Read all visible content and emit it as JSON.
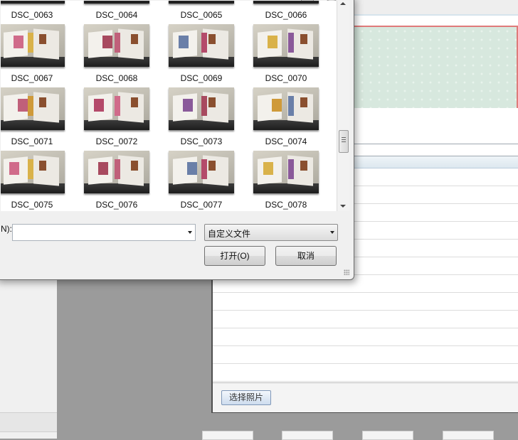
{
  "file_dialog": {
    "files": [
      {
        "name": "DSC_0063"
      },
      {
        "name": "DSC_0064"
      },
      {
        "name": "DSC_0065"
      },
      {
        "name": "DSC_0066"
      },
      {
        "name": "DSC_0067"
      },
      {
        "name": "DSC_0068"
      },
      {
        "name": "DSC_0069"
      },
      {
        "name": "DSC_0070"
      },
      {
        "name": "DSC_0071"
      },
      {
        "name": "DSC_0072"
      },
      {
        "name": "DSC_0073"
      },
      {
        "name": "DSC_0074"
      },
      {
        "name": "DSC_0075"
      },
      {
        "name": "DSC_0076"
      },
      {
        "name": "DSC_0077"
      },
      {
        "name": "DSC_0078"
      }
    ],
    "filename_label": "N):",
    "filename_value": "",
    "file_type_selected": "自定义文件",
    "open_button": "打开(O)",
    "cancel_button": "取消"
  },
  "background_app": {
    "select_photo_button": "选择照片",
    "accent_color": "#e07a7a",
    "preview_color": "#d7e8de"
  }
}
